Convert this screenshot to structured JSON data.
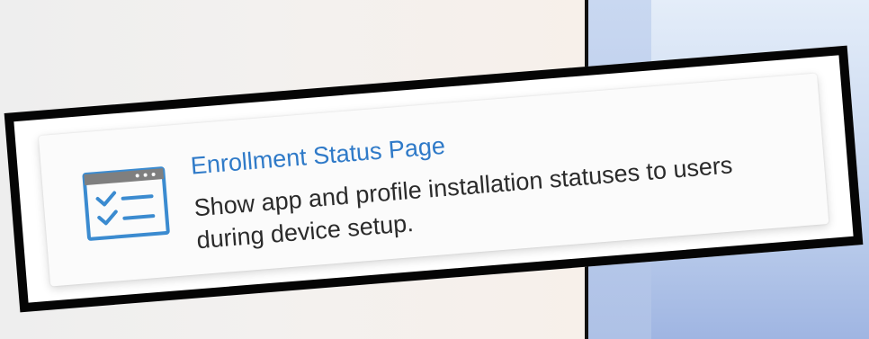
{
  "card": {
    "title": "Enrollment Status Page",
    "description": "Show app and profile installation statuses to users during device setup.",
    "icon": "checklist-window-icon"
  },
  "colors": {
    "title": "#2f7ac8",
    "icon": "#3b8bd0",
    "frame": "#050505"
  }
}
